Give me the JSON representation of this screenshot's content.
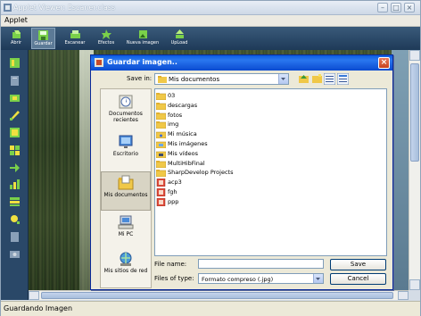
{
  "window": {
    "title": "Applet Viewer: Escaner.class"
  },
  "menu": {
    "items": [
      "Applet"
    ]
  },
  "toolbar": {
    "buttons": [
      {
        "label": "Abrir",
        "icon": "open-icon"
      },
      {
        "label": "Guardar",
        "icon": "save-icon",
        "active": true
      },
      {
        "label": "Escanear",
        "icon": "scan-icon"
      },
      {
        "label": "Efectos",
        "icon": "effects-icon"
      },
      {
        "label": "Nueva imagen",
        "icon": "new-image-icon"
      },
      {
        "label": "UpLoad",
        "icon": "upload-icon"
      }
    ]
  },
  "status": {
    "text": "Guardando Imagen"
  },
  "dialog": {
    "title": "Guardar imagen..",
    "save_in_label": "Save in:",
    "save_in_value": "Mis documentos",
    "places": [
      {
        "label": "Documentos recientes",
        "icon": "recent-documents-icon"
      },
      {
        "label": "Escritorio",
        "icon": "desktop-icon"
      },
      {
        "label": "Mis documentos",
        "icon": "my-documents-icon",
        "selected": true
      },
      {
        "label": "Mi PC",
        "icon": "my-computer-icon"
      },
      {
        "label": "Mis sitios de red",
        "icon": "network-places-icon"
      }
    ],
    "files": [
      {
        "name": "03",
        "type": "folder"
      },
      {
        "name": "descargas",
        "type": "folder"
      },
      {
        "name": "fotos",
        "type": "folder"
      },
      {
        "name": "img",
        "type": "folder"
      },
      {
        "name": "Mi música",
        "type": "music-folder"
      },
      {
        "name": "Mis imágenes",
        "type": "pictures-folder"
      },
      {
        "name": "Mis vídeos",
        "type": "video-folder"
      },
      {
        "name": "MultiHibFinal",
        "type": "folder"
      },
      {
        "name": "SharpDevelop Projects",
        "type": "folder"
      },
      {
        "name": "acp3",
        "type": "file"
      },
      {
        "name": "fgh",
        "type": "file"
      },
      {
        "name": "ppp",
        "type": "file"
      }
    ],
    "filename_label": "File name:",
    "filename_value": "",
    "filetype_label": "Files of type:",
    "filetype_value": "Formato compreso (.jpg)",
    "save_label": "Save",
    "cancel_label": "Cancel"
  },
  "colors": {
    "toolbar": "#2a4868",
    "dialog_title": "#0a5ae0",
    "dialog_bg": "#ece9d8"
  }
}
